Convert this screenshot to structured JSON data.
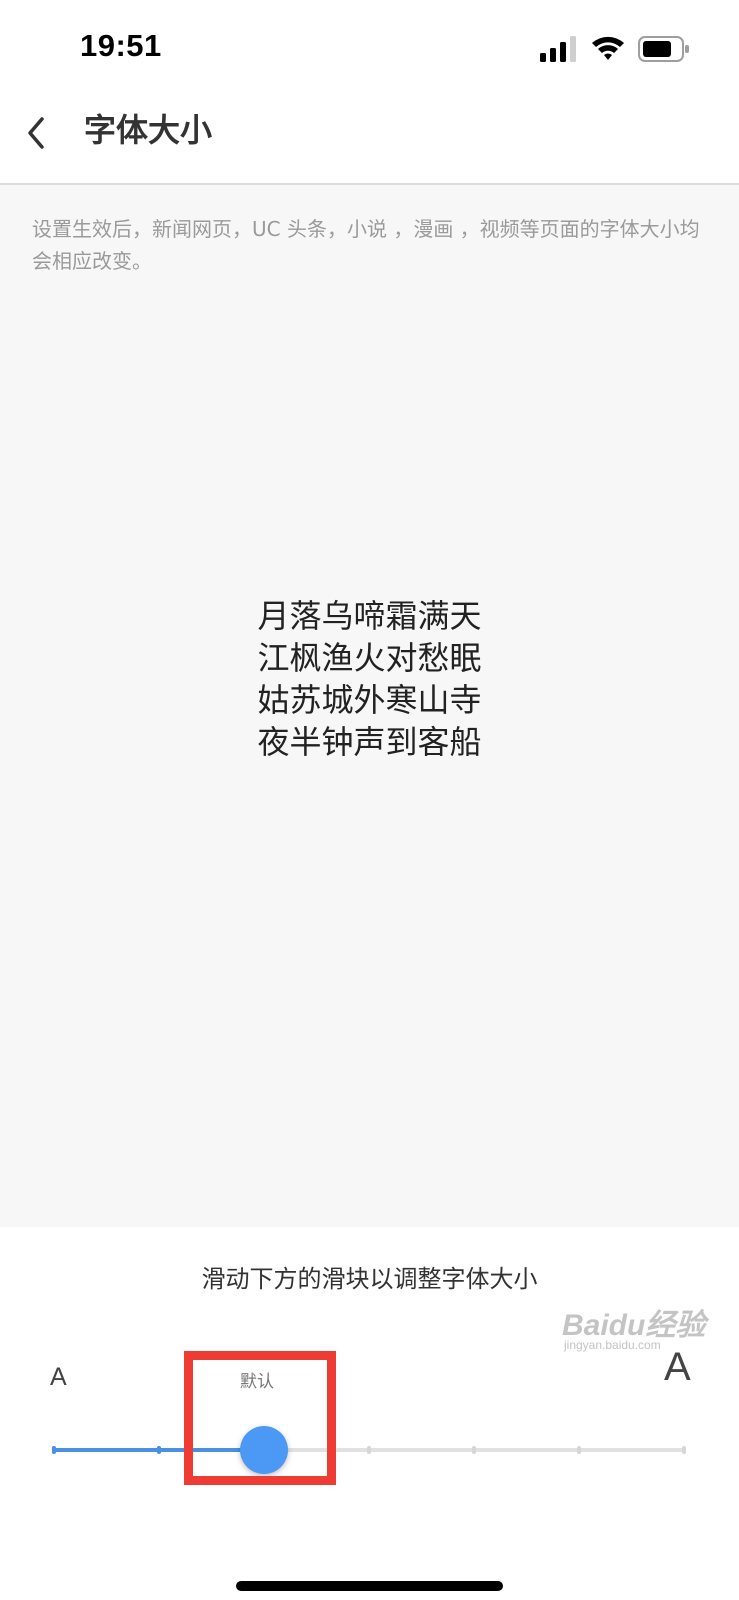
{
  "status_bar": {
    "time": "19:51",
    "icons": [
      "cellular-signal-icon",
      "wifi-icon",
      "battery-icon"
    ]
  },
  "nav": {
    "back_icon": "chevron-left-icon",
    "title": "字体大小"
  },
  "preview": {
    "hint": "设置生效后，新闻网页，UC 头条，小说 ，漫画 ，视频等页面的字体大小均会相应改变。",
    "poem_lines": [
      "月落乌啼霜满天",
      "江枫渔火对愁眠",
      "姑苏城外寒山寺",
      "夜半钟声到客船"
    ]
  },
  "controls": {
    "instruction": "滑动下方的滑块以调整字体大小",
    "small_label": "A",
    "large_label": "A",
    "default_label": "默认",
    "slider": {
      "steps": 7,
      "selected_index": 2,
      "default_index": 2
    }
  },
  "watermark": {
    "brand": "Baidu经验",
    "sub": "jingyan.baidu.com"
  },
  "colors": {
    "accent": "#4a90e2",
    "thumb": "#4b98f5",
    "highlight": "#ee3b33"
  }
}
